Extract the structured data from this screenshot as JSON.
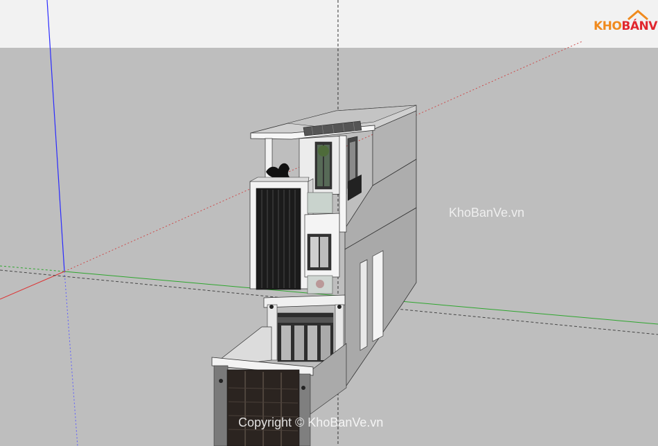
{
  "app": {
    "name": "SketchUp 3D model viewport"
  },
  "logo": {
    "part1": "KHO",
    "part2": "BÁN",
    "part3": "VẼ"
  },
  "watermark": {
    "side": "KhoBanVe.vn",
    "bottom": "Copyright © KhoBanVe.vn"
  },
  "colors": {
    "sky": "#f2f2f2",
    "ground": "#bebebe",
    "axis_blue": "#2a2aff",
    "axis_red": "#d33",
    "axis_green": "#2da62d",
    "logo_orange": "#f08a1e",
    "logo_red": "#e1262e"
  }
}
